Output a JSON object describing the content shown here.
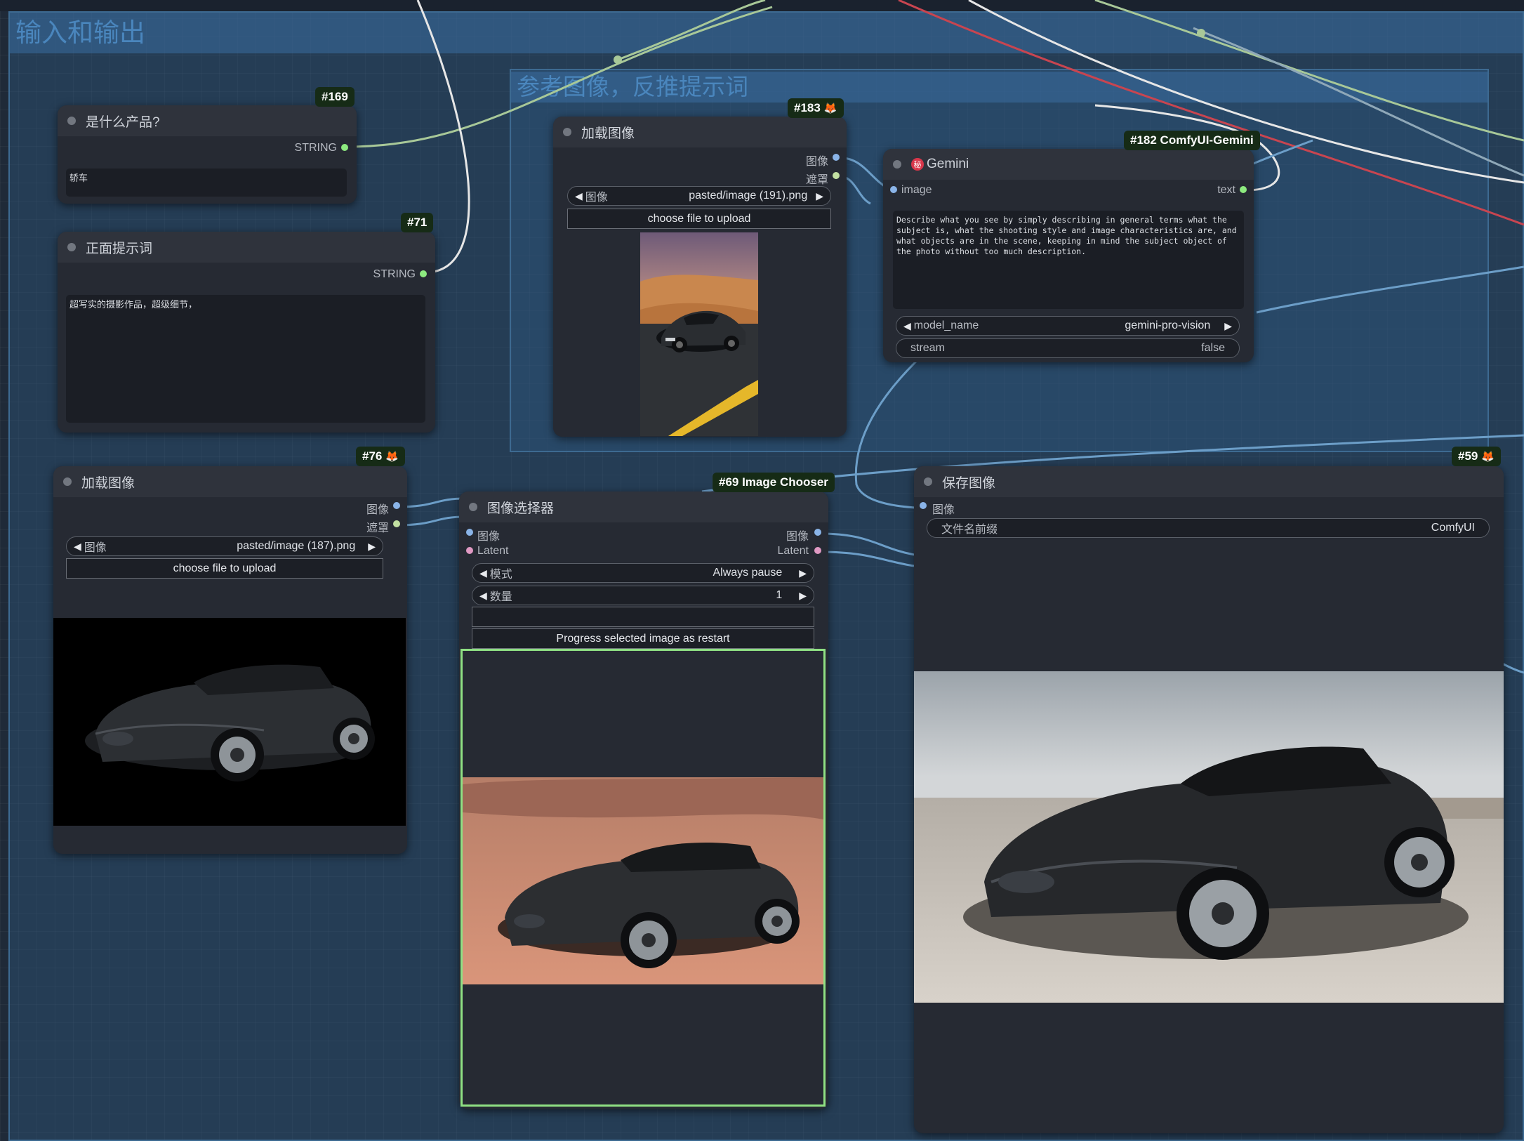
{
  "groups": {
    "outer_title": "输入和输出",
    "inner_title": "参考图像，反推提示词"
  },
  "colors": {
    "canvas_bg": "#1f2a38",
    "group_fill": "#305c87",
    "node_bg": "#262a33",
    "badge_bg": "#162b16",
    "link_green": "#a8c898",
    "link_white": "#e6e6e6",
    "link_red": "#c84550",
    "link_blue": "#6c9ec8",
    "selection": "#8fe083"
  },
  "nodes": {
    "n169": {
      "badge": "#169",
      "title": "是什么产品?",
      "output_label": "STRING",
      "text_value": "轿车"
    },
    "n71": {
      "badge": "#71",
      "title": "正面提示词",
      "output_label": "STRING",
      "text_value": "超写实的摄影作品，超级细节，"
    },
    "n183": {
      "badge": "#183",
      "badge_icon": "fox-icon",
      "title": "加载图像",
      "output_image": "图像",
      "output_mask": "遮罩",
      "image_widget_label": "图像",
      "image_widget_value": "pasted/image (191).png",
      "upload_label": "choose file to upload",
      "preview_icon": "car-desert-road-preview"
    },
    "n182": {
      "badge": "#182 ComfyUI-Gemini",
      "title": "Gemini",
      "title_icon": "gemini-logo-icon",
      "title_icon_text": "秘",
      "input_image": "image",
      "output_text": "text",
      "prompt": "Describe what you see by simply describing in general terms what the subject is, what the shooting style and image characteristics are, and what objects are in the scene, keeping in mind the subject object of the photo without too much description.",
      "model_name_label": "model_name",
      "model_name_value": "gemini-pro-vision",
      "stream_label": "stream",
      "stream_value": "false"
    },
    "n76": {
      "badge": "#76",
      "badge_icon": "fox-icon",
      "title": "加载图像",
      "output_image": "图像",
      "output_mask": "遮罩",
      "image_widget_label": "图像",
      "image_widget_value": "pasted/image (187).png",
      "upload_label": "choose file to upload",
      "preview_icon": "car-black-bg-preview"
    },
    "n69": {
      "badge": "#69 Image Chooser",
      "title": "图像选择器",
      "input_image": "图像",
      "input_latent": "Latent",
      "output_image": "图像",
      "output_latent": "Latent",
      "mode_label": "模式",
      "mode_value": "Always pause",
      "count_label": "数量",
      "count_value": "1",
      "progress_button": "Progress selected image as restart",
      "preview_icon": "car-desert-preview"
    },
    "n59": {
      "badge": "#59",
      "badge_icon": "fox-icon",
      "title": "保存图像",
      "input_image": "图像",
      "prefix_label": "文件名前缀",
      "prefix_value": "ComfyUI",
      "preview_icon": "car-sky-preview"
    }
  }
}
